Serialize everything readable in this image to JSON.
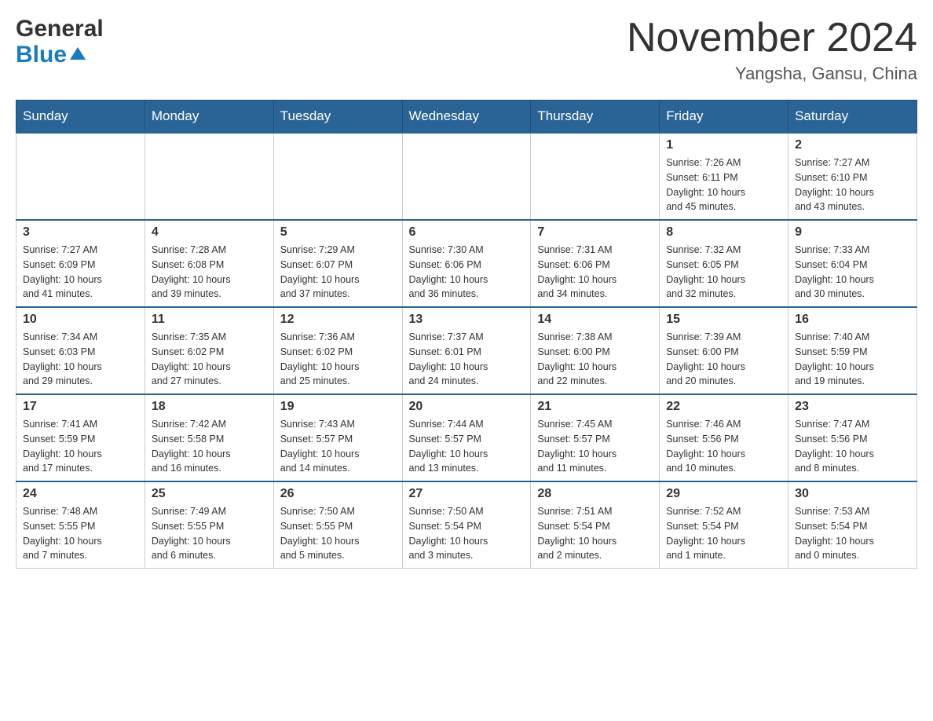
{
  "header": {
    "logo": {
      "general": "General",
      "blue": "Blue"
    },
    "title": "November 2024",
    "location": "Yangsha, Gansu, China"
  },
  "weekdays": [
    "Sunday",
    "Monday",
    "Tuesday",
    "Wednesday",
    "Thursday",
    "Friday",
    "Saturday"
  ],
  "weeks": [
    [
      {
        "day": "",
        "info": ""
      },
      {
        "day": "",
        "info": ""
      },
      {
        "day": "",
        "info": ""
      },
      {
        "day": "",
        "info": ""
      },
      {
        "day": "",
        "info": ""
      },
      {
        "day": "1",
        "info": "Sunrise: 7:26 AM\nSunset: 6:11 PM\nDaylight: 10 hours\nand 45 minutes."
      },
      {
        "day": "2",
        "info": "Sunrise: 7:27 AM\nSunset: 6:10 PM\nDaylight: 10 hours\nand 43 minutes."
      }
    ],
    [
      {
        "day": "3",
        "info": "Sunrise: 7:27 AM\nSunset: 6:09 PM\nDaylight: 10 hours\nand 41 minutes."
      },
      {
        "day": "4",
        "info": "Sunrise: 7:28 AM\nSunset: 6:08 PM\nDaylight: 10 hours\nand 39 minutes."
      },
      {
        "day": "5",
        "info": "Sunrise: 7:29 AM\nSunset: 6:07 PM\nDaylight: 10 hours\nand 37 minutes."
      },
      {
        "day": "6",
        "info": "Sunrise: 7:30 AM\nSunset: 6:06 PM\nDaylight: 10 hours\nand 36 minutes."
      },
      {
        "day": "7",
        "info": "Sunrise: 7:31 AM\nSunset: 6:06 PM\nDaylight: 10 hours\nand 34 minutes."
      },
      {
        "day": "8",
        "info": "Sunrise: 7:32 AM\nSunset: 6:05 PM\nDaylight: 10 hours\nand 32 minutes."
      },
      {
        "day": "9",
        "info": "Sunrise: 7:33 AM\nSunset: 6:04 PM\nDaylight: 10 hours\nand 30 minutes."
      }
    ],
    [
      {
        "day": "10",
        "info": "Sunrise: 7:34 AM\nSunset: 6:03 PM\nDaylight: 10 hours\nand 29 minutes."
      },
      {
        "day": "11",
        "info": "Sunrise: 7:35 AM\nSunset: 6:02 PM\nDaylight: 10 hours\nand 27 minutes."
      },
      {
        "day": "12",
        "info": "Sunrise: 7:36 AM\nSunset: 6:02 PM\nDaylight: 10 hours\nand 25 minutes."
      },
      {
        "day": "13",
        "info": "Sunrise: 7:37 AM\nSunset: 6:01 PM\nDaylight: 10 hours\nand 24 minutes."
      },
      {
        "day": "14",
        "info": "Sunrise: 7:38 AM\nSunset: 6:00 PM\nDaylight: 10 hours\nand 22 minutes."
      },
      {
        "day": "15",
        "info": "Sunrise: 7:39 AM\nSunset: 6:00 PM\nDaylight: 10 hours\nand 20 minutes."
      },
      {
        "day": "16",
        "info": "Sunrise: 7:40 AM\nSunset: 5:59 PM\nDaylight: 10 hours\nand 19 minutes."
      }
    ],
    [
      {
        "day": "17",
        "info": "Sunrise: 7:41 AM\nSunset: 5:59 PM\nDaylight: 10 hours\nand 17 minutes."
      },
      {
        "day": "18",
        "info": "Sunrise: 7:42 AM\nSunset: 5:58 PM\nDaylight: 10 hours\nand 16 minutes."
      },
      {
        "day": "19",
        "info": "Sunrise: 7:43 AM\nSunset: 5:57 PM\nDaylight: 10 hours\nand 14 minutes."
      },
      {
        "day": "20",
        "info": "Sunrise: 7:44 AM\nSunset: 5:57 PM\nDaylight: 10 hours\nand 13 minutes."
      },
      {
        "day": "21",
        "info": "Sunrise: 7:45 AM\nSunset: 5:57 PM\nDaylight: 10 hours\nand 11 minutes."
      },
      {
        "day": "22",
        "info": "Sunrise: 7:46 AM\nSunset: 5:56 PM\nDaylight: 10 hours\nand 10 minutes."
      },
      {
        "day": "23",
        "info": "Sunrise: 7:47 AM\nSunset: 5:56 PM\nDaylight: 10 hours\nand 8 minutes."
      }
    ],
    [
      {
        "day": "24",
        "info": "Sunrise: 7:48 AM\nSunset: 5:55 PM\nDaylight: 10 hours\nand 7 minutes."
      },
      {
        "day": "25",
        "info": "Sunrise: 7:49 AM\nSunset: 5:55 PM\nDaylight: 10 hours\nand 6 minutes."
      },
      {
        "day": "26",
        "info": "Sunrise: 7:50 AM\nSunset: 5:55 PM\nDaylight: 10 hours\nand 5 minutes."
      },
      {
        "day": "27",
        "info": "Sunrise: 7:50 AM\nSunset: 5:54 PM\nDaylight: 10 hours\nand 3 minutes."
      },
      {
        "day": "28",
        "info": "Sunrise: 7:51 AM\nSunset: 5:54 PM\nDaylight: 10 hours\nand 2 minutes."
      },
      {
        "day": "29",
        "info": "Sunrise: 7:52 AM\nSunset: 5:54 PM\nDaylight: 10 hours\nand 1 minute."
      },
      {
        "day": "30",
        "info": "Sunrise: 7:53 AM\nSunset: 5:54 PM\nDaylight: 10 hours\nand 0 minutes."
      }
    ]
  ]
}
